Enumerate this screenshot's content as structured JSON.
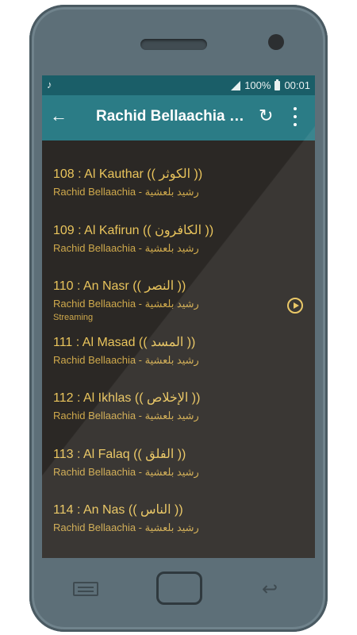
{
  "status_bar": {
    "music_icon": "music-note-icon",
    "battery": "100%",
    "time": "00:01"
  },
  "app_bar": {
    "title": "Rachid Bellaachia - ..."
  },
  "tracks": [
    {
      "title": "108 : Al Kauthar (( الكوثر ))",
      "subtitle": "Rachid Bellaachia - رشيد بلعشية"
    },
    {
      "title": "109 : Al Kafirun (( الكافرون ))",
      "subtitle": "Rachid Bellaachia - رشيد بلعشية"
    },
    {
      "title": "110 : An Nasr (( النصر ))",
      "subtitle": "Rachid Bellaachia - رشيد بلعشية",
      "status": "Streaming"
    },
    {
      "title": "111 : Al Masad (( المسد ))",
      "subtitle": "Rachid Bellaachia - رشيد بلعشية"
    },
    {
      "title": "112 : Al Ikhlas (( الإخلاص ))",
      "subtitle": "Rachid Bellaachia - رشيد بلعشية"
    },
    {
      "title": "113 : Al Falaq (( الفلق ))",
      "subtitle": "Rachid Bellaachia - رشيد بلعشية"
    },
    {
      "title": "114 : An Nas (( الناس ))",
      "subtitle": "Rachid Bellaachia - رشيد بلعشية"
    }
  ],
  "colors": {
    "accent_text": "#e9c45c",
    "app_bar": "#2b7c86",
    "status_bar": "#1a5e68",
    "list_background": "#2b2825",
    "phone_body": "#5d6f78"
  }
}
